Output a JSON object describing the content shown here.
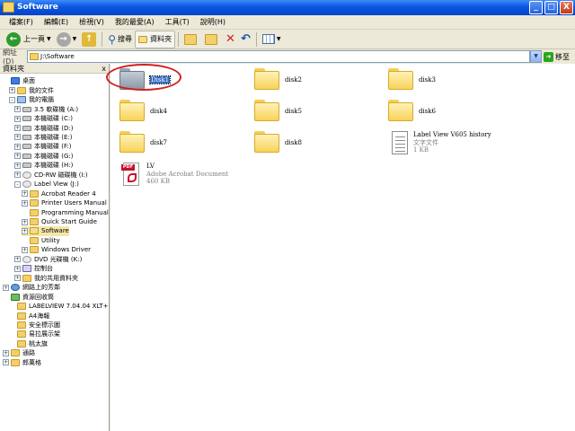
{
  "window": {
    "title": "Software",
    "buttons": [
      "_",
      "□",
      "X"
    ]
  },
  "menu": [
    "檔案(F)",
    "編輯(E)",
    "檢視(V)",
    "我的最愛(A)",
    "工具(T)",
    "說明(H)"
  ],
  "toolbar": {
    "back": "上一頁",
    "search": "搜尋",
    "folders": "資料夾"
  },
  "address": {
    "label": "網址(D)",
    "value": "J:\\Software",
    "go": "移至"
  },
  "sidebar": {
    "title": "資料夾",
    "close": "x",
    "tree": [
      {
        "label": "桌面",
        "icon": "desktop"
      },
      {
        "label": "我的文件",
        "icon": "folder",
        "exp": "+"
      },
      {
        "label": "我的電腦",
        "icon": "computer",
        "exp": "-"
      },
      {
        "label": "3.5 軟碟機 (A:)",
        "icon": "drive",
        "exp": "+"
      },
      {
        "label": "本機磁碟 (C:)",
        "icon": "drive",
        "exp": "+"
      },
      {
        "label": "本機磁碟 (D:)",
        "icon": "drive",
        "exp": "+"
      },
      {
        "label": "本機磁碟 (E:)",
        "icon": "drive",
        "exp": "+"
      },
      {
        "label": "本機磁碟 (F:)",
        "icon": "drive",
        "exp": "+"
      },
      {
        "label": "本機磁碟 (G:)",
        "icon": "drive",
        "exp": "+"
      },
      {
        "label": "本機磁碟 (H:)",
        "icon": "drive",
        "exp": "+"
      },
      {
        "label": "CD-RW 磁碟機 (I:)",
        "icon": "cd",
        "exp": "+"
      },
      {
        "label": "Label View (J:)",
        "icon": "cd",
        "exp": "-"
      },
      {
        "label": "Acrobat Reader 4",
        "icon": "folder",
        "exp": "+"
      },
      {
        "label": "Printer Users Manual",
        "icon": "folder",
        "exp": "+"
      },
      {
        "label": "Programming Manual",
        "icon": "folder"
      },
      {
        "label": "Quick Start Guide",
        "icon": "folder",
        "exp": "+"
      },
      {
        "label": "Software",
        "icon": "open",
        "exp": "+"
      },
      {
        "label": "Utility",
        "icon": "folder"
      },
      {
        "label": "Windows Driver",
        "icon": "folder",
        "exp": "+"
      },
      {
        "label": "DVD 光碟機 (K:)",
        "icon": "cd",
        "exp": "+"
      },
      {
        "label": "控制台",
        "icon": "control",
        "exp": "+"
      },
      {
        "label": "我的共用資料夾",
        "icon": "folder",
        "exp": "+"
      },
      {
        "label": "網路上的芳鄰",
        "icon": "network",
        "exp": "+"
      },
      {
        "label": "資源回收筒",
        "icon": "bin"
      },
      {
        "label": "LABELVIEW 7.04.04 XLT+",
        "icon": "folder"
      },
      {
        "label": "A4海報",
        "icon": "folder"
      },
      {
        "label": "安全標示圖",
        "icon": "folder"
      },
      {
        "label": "易拉展示架",
        "icon": "folder"
      },
      {
        "label": "桃太旗",
        "icon": "folder"
      },
      {
        "label": "通路",
        "icon": "folder",
        "exp": "+"
      },
      {
        "label": "郎萬格",
        "icon": "folder",
        "exp": "+"
      }
    ]
  },
  "files": [
    {
      "name": "Disk1",
      "type": "folder-selected"
    },
    {
      "name": "disk2",
      "type": "folder"
    },
    {
      "name": "disk3",
      "type": "folder"
    },
    {
      "name": "disk4",
      "type": "folder"
    },
    {
      "name": "disk5",
      "type": "folder"
    },
    {
      "name": "disk6",
      "type": "folder"
    },
    {
      "name": "disk7",
      "type": "folder"
    },
    {
      "name": "disk8",
      "type": "folder"
    },
    {
      "name": "Label View V605 history",
      "type": "text",
      "kind": "文字文件",
      "size": "1 KB"
    },
    {
      "name": "LV",
      "type": "pdf",
      "kind": "Adobe Acrobat Document",
      "size": "460 KB"
    }
  ],
  "colors": {
    "titlebar": "#0a55e0",
    "selection": "#316ac5",
    "annotation": "#d12020"
  }
}
